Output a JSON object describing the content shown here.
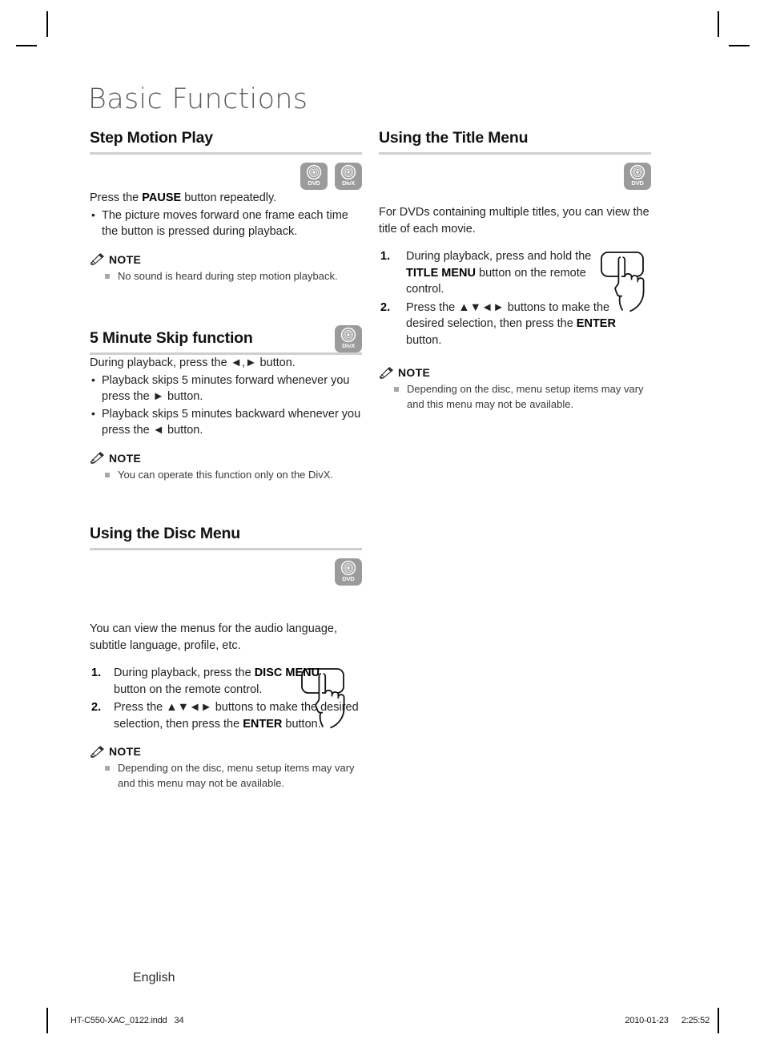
{
  "page": {
    "chapter_title": "Basic Functions",
    "language_footer": "English",
    "imprint_file": "HT-C550-XAC_0122.indd",
    "imprint_page": "34",
    "stamp_date": "2010-01-23",
    "stamp_time": "2:25:52"
  },
  "icons": {
    "dvd_label": "DVD",
    "divx_label": "DivX",
    "note_icon": "pencil-icon",
    "hand_icon": "hand-pressing-button-icon"
  },
  "colors": {
    "badge_gray": "#9b9b9b",
    "rule_gray": "#cfcfcf",
    "title_gray": "#5c5c5c",
    "note_square": "#a8a8a8"
  },
  "sections": {
    "step_motion_play": {
      "heading": "Step Motion Play",
      "badges": [
        "DVD",
        "DivX"
      ],
      "lead": "Press the PAUSE button repeatedly.",
      "lead_parts": {
        "a": "Press the ",
        "b": "PAUSE",
        "c": " button repeatedly."
      },
      "bullets": [
        "The picture moves forward one frame each time the button is pressed during playback."
      ],
      "note": {
        "label": "NOTE",
        "items": [
          "No sound is heard during step motion playback."
        ]
      }
    },
    "five_minute_skip": {
      "heading": "5 Minute Skip function",
      "badges": [
        "DivX"
      ],
      "lead_parts": {
        "a": "During playback, press the ",
        "b": "◄,►",
        "c": " button."
      },
      "bullets": [
        "Playback skips 5 minutes forward whenever you press the ► button.",
        "Playback skips 5 minutes backward whenever you press the ◄ button."
      ],
      "note": {
        "label": "NOTE",
        "items": [
          "You can operate this function only on the DivX."
        ]
      }
    },
    "using_disc_menu": {
      "heading": "Using the Disc Menu",
      "badges": [
        "DVD"
      ],
      "lead": "You can view the menus for the audio language, subtitle language, profile, etc.",
      "steps": [
        {
          "num": "1.",
          "parts": {
            "a": "During playback, press the ",
            "b": "DISC MENU",
            "c": " button on the remote control."
          }
        },
        {
          "num": "2.",
          "parts": {
            "a": "Press the ",
            "b": "▲▼◄►",
            "c": " buttons to make the desired selection, then press the ",
            "d": "ENTER",
            "e": " button."
          }
        }
      ],
      "note": {
        "label": "NOTE",
        "items": [
          "Depending on the disc, menu setup items may vary and this menu may not be available."
        ]
      }
    },
    "using_title_menu": {
      "heading": "Using the Title Menu",
      "badges": [
        "DVD"
      ],
      "lead": "For DVDs containing multiple titles, you can view the title of each movie.",
      "steps": [
        {
          "num": "1.",
          "parts": {
            "a": "During playback, press and hold the ",
            "b": "TITLE MENU",
            "c": " button on the remote control."
          }
        },
        {
          "num": "2.",
          "parts": {
            "a": "Press the ",
            "b": "▲▼◄►",
            "c": " buttons to make the desired selection, then press the ",
            "d": "ENTER",
            "e": " button."
          }
        }
      ],
      "note": {
        "label": "NOTE",
        "items": [
          "Depending on the disc, menu setup items may vary and this menu may not be available."
        ]
      }
    }
  }
}
